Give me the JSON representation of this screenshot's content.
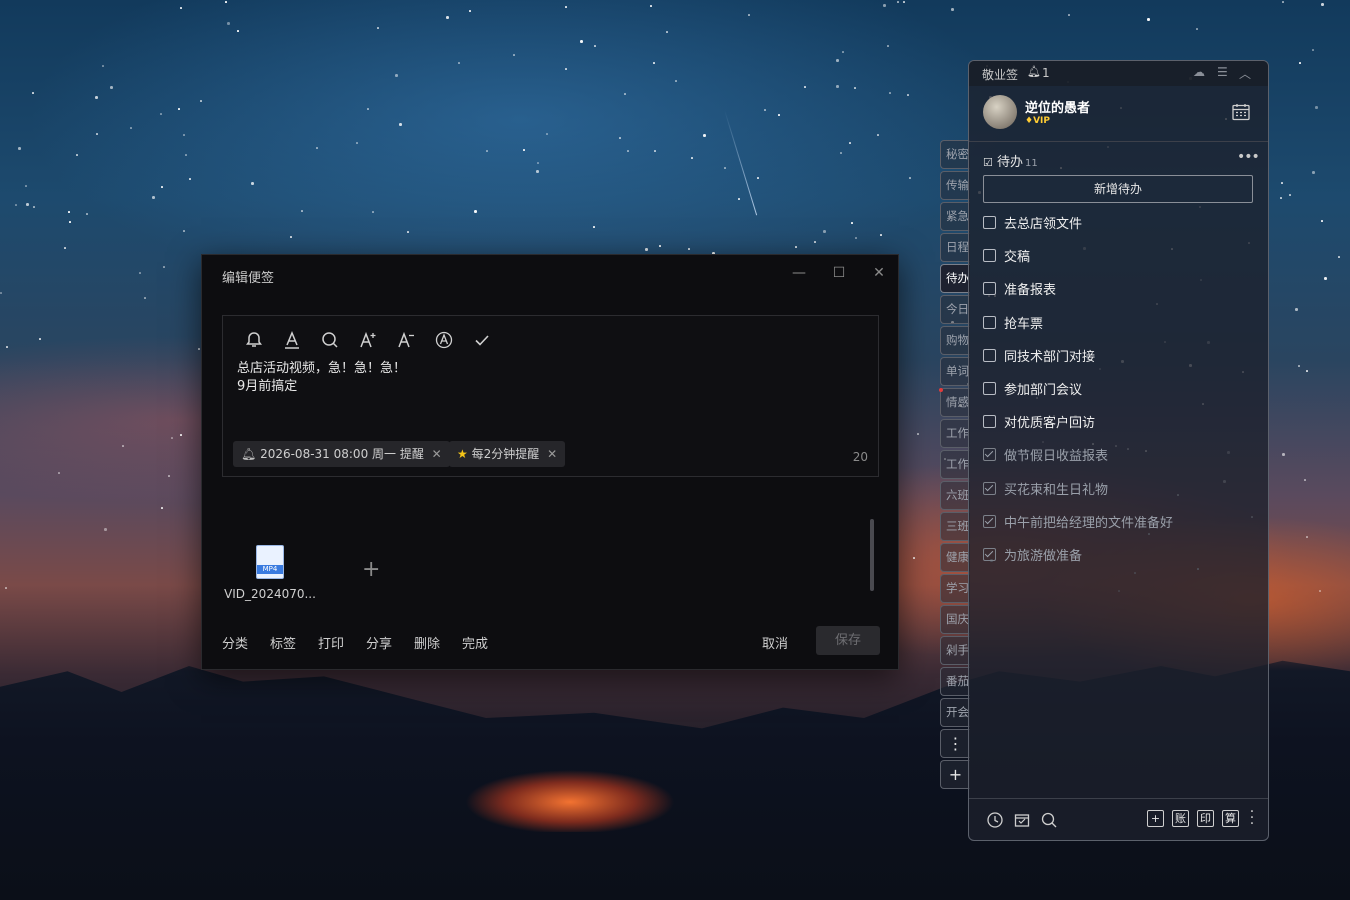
{
  "editor": {
    "title": "编辑便签",
    "content_line1": "总店活动视频，急！急！急！",
    "content_line2": "9月前搞定",
    "reminder_chip": "2026-08-31 08:00 周一 提醒",
    "repeat_chip": "每2分钟提醒",
    "char_count": "20",
    "attachment_name": "VID_2024070...",
    "attachment_badge": "MP4",
    "footer": {
      "category": "分类",
      "tag": "标签",
      "print": "打印",
      "share": "分享",
      "delete": "删除",
      "done": "完成",
      "cancel": "取消",
      "save": "保存"
    }
  },
  "side_tabs": [
    "秘密",
    "传输",
    "紧急",
    "日程",
    "待办",
    "今日",
    "购物",
    "单词",
    "情感",
    "工作",
    "工作",
    "六班",
    "三班",
    "健康",
    "学习",
    "国庆",
    "剁手",
    "番茄",
    "开会"
  ],
  "panel": {
    "app_title": "敬业签",
    "notification_count": "1",
    "username": "逆位的愚者",
    "vip_label": "VIP",
    "section_title": "待办",
    "section_count": "11",
    "new_todo_label": "新增待办",
    "todos": [
      {
        "text": "去总店领文件",
        "done": false
      },
      {
        "text": "交稿",
        "done": false
      },
      {
        "text": "准备报表",
        "done": false
      },
      {
        "text": "抢车票",
        "done": false
      },
      {
        "text": "同技术部门对接",
        "done": false
      },
      {
        "text": "参加部门会议",
        "done": false
      },
      {
        "text": "对优质客户回访",
        "done": false
      },
      {
        "text": "做节假日收益报表",
        "done": true
      },
      {
        "text": "买花束和生日礼物",
        "done": true
      },
      {
        "text": "中午前把给经理的文件准备好",
        "done": true
      },
      {
        "text": "为旅游做准备",
        "done": true
      }
    ],
    "bottom_buttons": {
      "add": "+",
      "account": "账",
      "print": "印",
      "calc": "算"
    }
  }
}
